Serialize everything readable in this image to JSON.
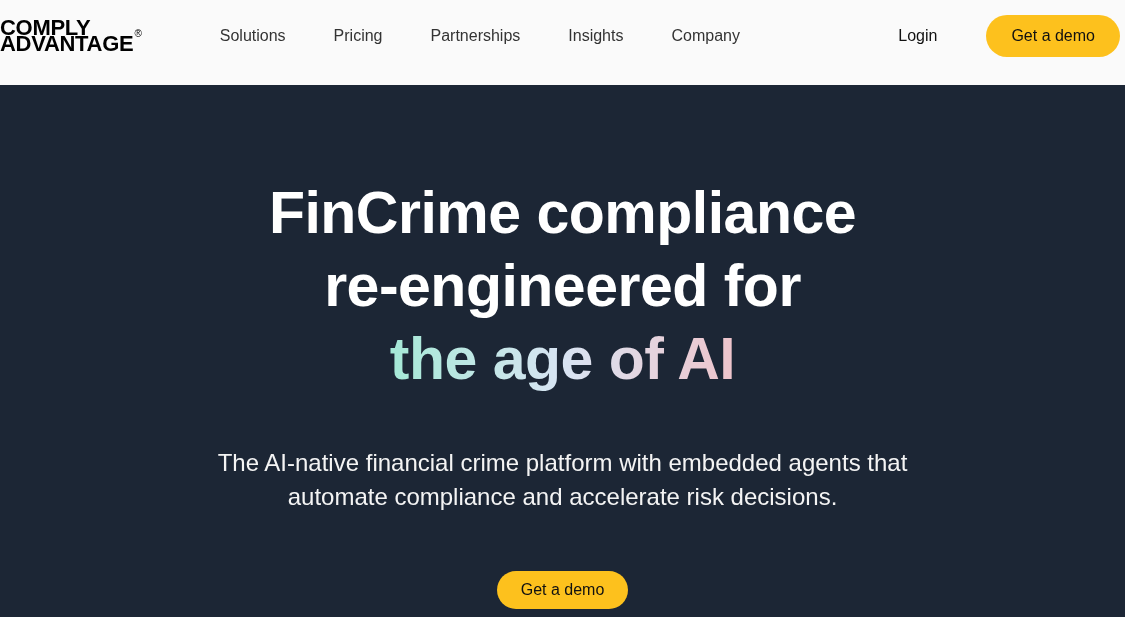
{
  "header": {
    "logo": {
      "lines": [
        "COMPLY",
        "ADVANTAGE"
      ],
      "mark": "®"
    },
    "nav_items": [
      "Solutions",
      "Pricing",
      "Partnerships",
      "Insights",
      "Company"
    ],
    "login": "Login",
    "cta": "Get a demo"
  },
  "hero": {
    "headline": [
      {
        "text": "FinCrime compliance",
        "kind": "plain"
      },
      {
        "text": "re-engineered for",
        "kind": "plain"
      },
      {
        "text": "the age of AI",
        "kind": "gradient"
      }
    ],
    "subtitle": "The AI-native financial crime platform with embedded agents that automate compliance and accelerate risk decisions.",
    "cta": "Get a demo"
  }
}
